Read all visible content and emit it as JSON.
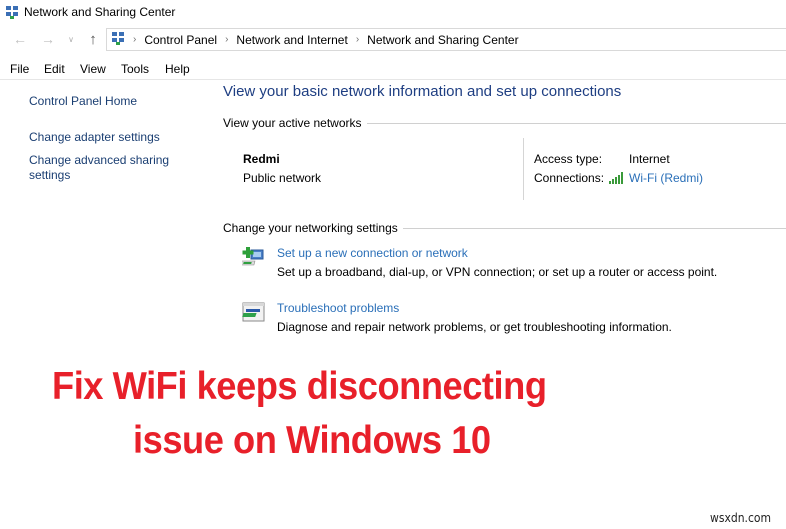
{
  "window": {
    "title": "Network and Sharing Center",
    "icon": "network-center-icon"
  },
  "navigation": {
    "back_icon": "arrow-left-icon",
    "forward_icon": "arrow-right-icon",
    "recent_icon": "chevron-down-icon",
    "up_icon": "arrow-up-icon",
    "breadcrumb": [
      "Control Panel",
      "Network and Internet",
      "Network and Sharing Center"
    ],
    "separator": "›"
  },
  "menu": {
    "items": [
      "File",
      "Edit",
      "View",
      "Tools",
      "Help"
    ]
  },
  "sidebar": {
    "items": [
      {
        "label": "Control Panel Home"
      },
      {
        "label": "Change adapter settings"
      },
      {
        "label": "Change advanced sharing settings"
      }
    ]
  },
  "main": {
    "heading": "View your basic network information and set up connections",
    "active_networks": {
      "section_label": "View your active networks",
      "network_name": "Redmi",
      "network_type": "Public network",
      "access_type_label": "Access type:",
      "access_type_value": "Internet",
      "connections_label": "Connections:",
      "connection_link": "Wi-Fi (Redmi)",
      "connection_icon": "wifi-signal-icon"
    },
    "change_settings": {
      "section_label": "Change your networking settings",
      "tasks": [
        {
          "icon": "new-connection-icon",
          "link": "Set up a new connection or network",
          "description": "Set up a broadband, dial-up, or VPN connection; or set up a router or access point."
        },
        {
          "icon": "troubleshoot-icon",
          "link": "Troubleshoot problems",
          "description": "Diagnose and repair network problems, or get troubleshooting information."
        }
      ]
    }
  },
  "overlay": {
    "line1": "Fix WiFi keeps disconnecting",
    "line2": "issue on Windows 10",
    "color": "#e8202a"
  },
  "watermark": "wsxdn.com",
  "colors": {
    "link": "#2a6fb8",
    "heading": "#1e3e82",
    "sidebar_link": "#1a3e72"
  }
}
